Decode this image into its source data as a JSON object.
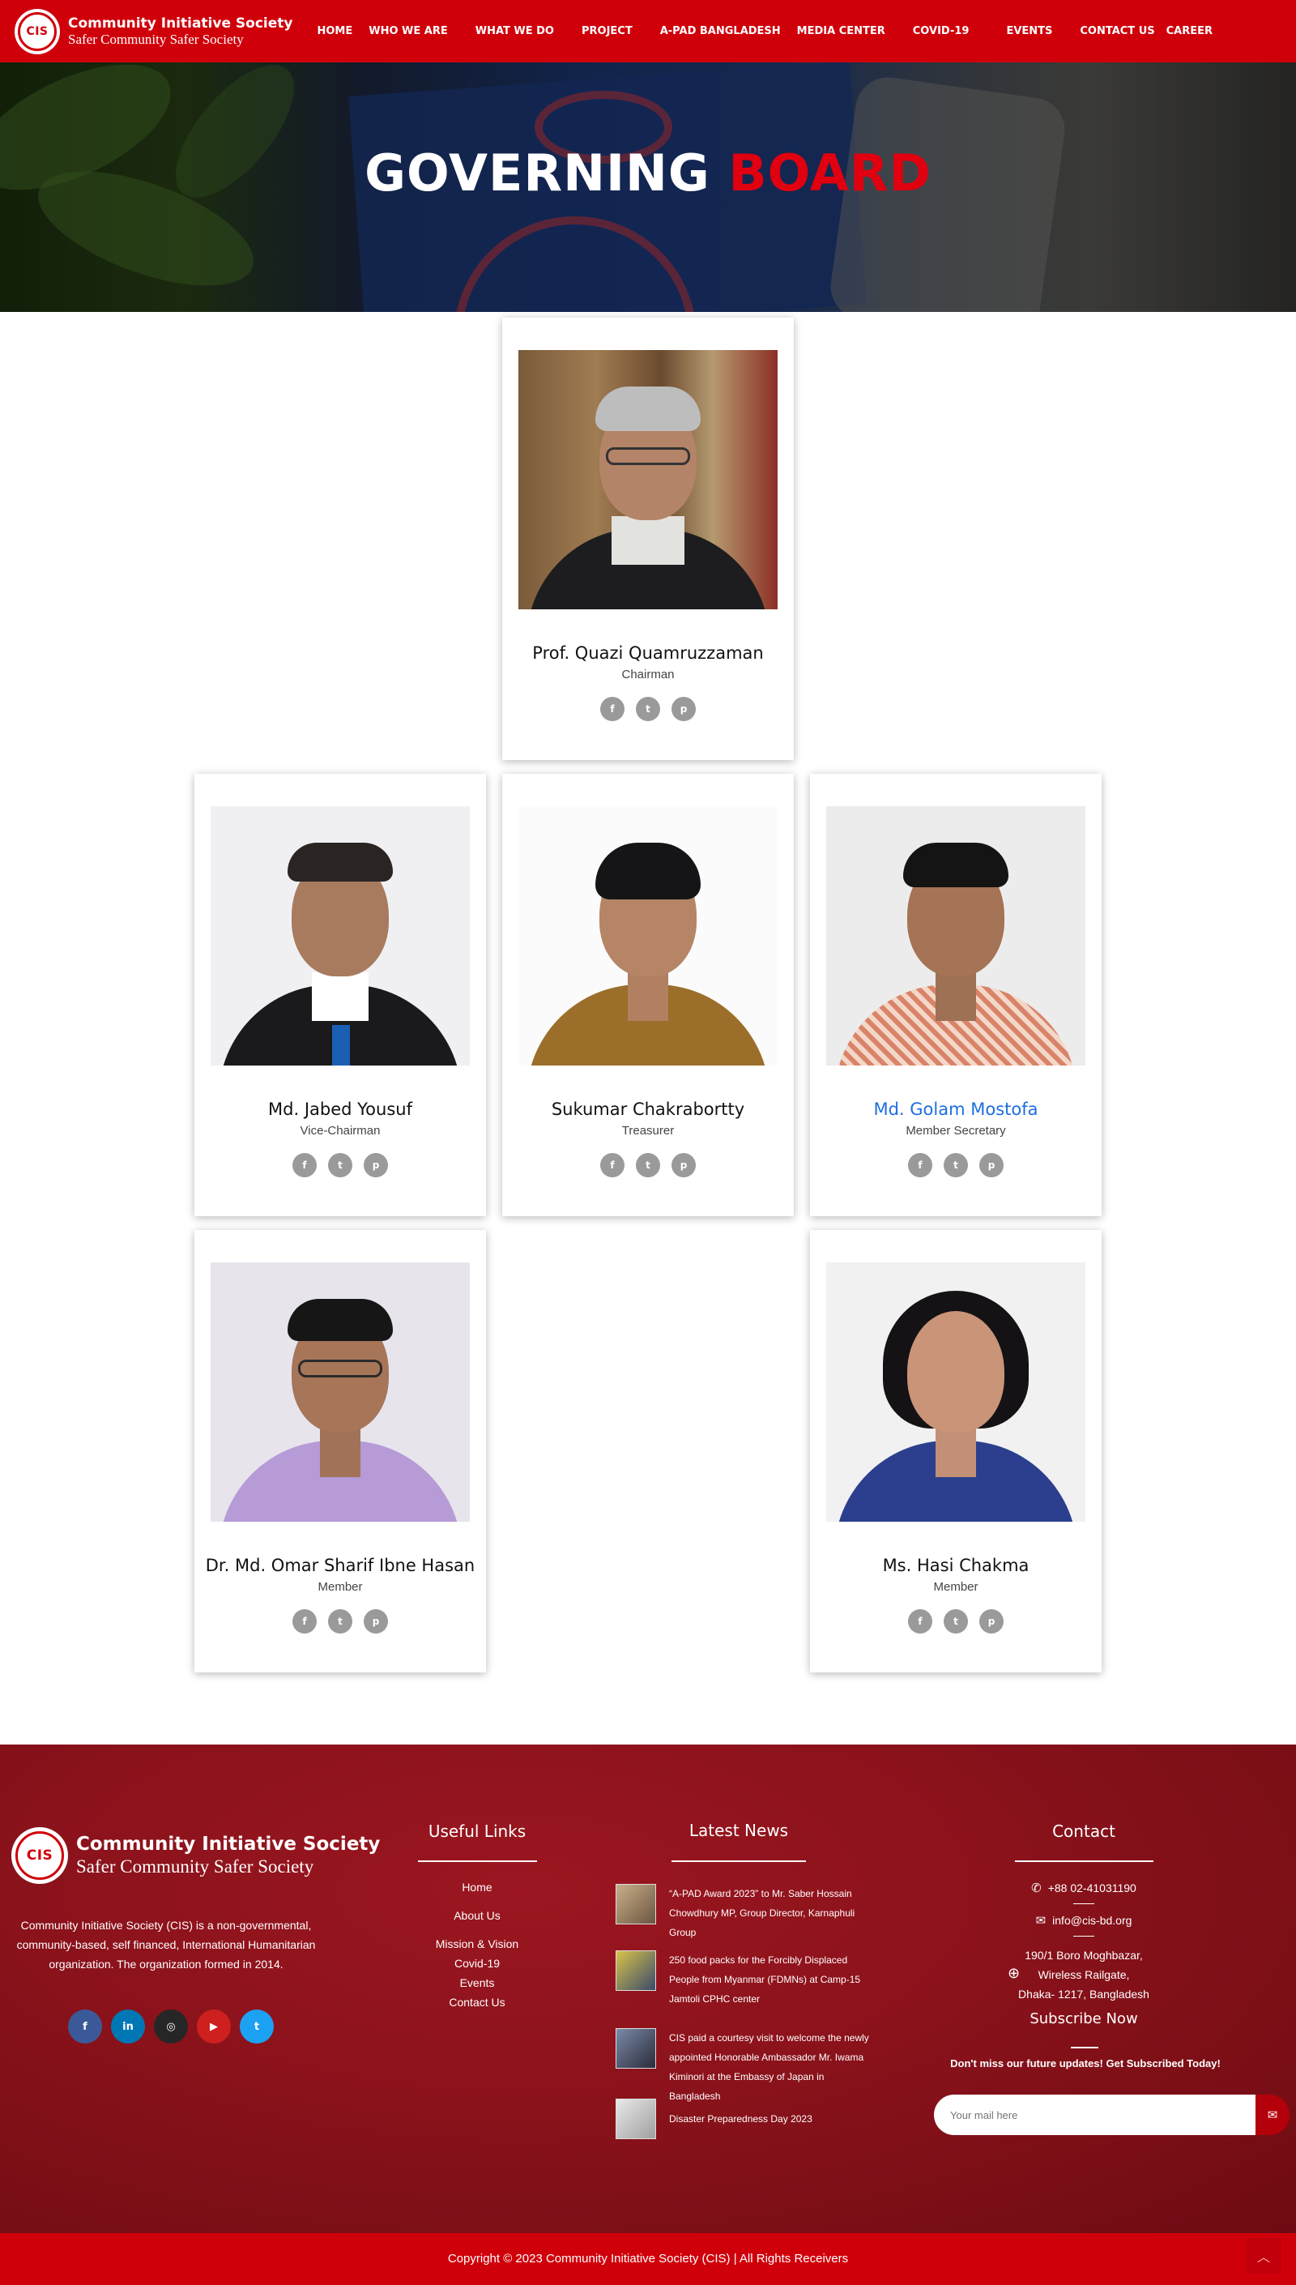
{
  "site": {
    "logo_text": "CIS",
    "name": "Community Initiative Society",
    "tagline": "Safer Community Safer Society"
  },
  "nav": {
    "items": [
      {
        "label": "HOME"
      },
      {
        "label": "WHO WE ARE"
      },
      {
        "label": "WHAT WE DO"
      },
      {
        "label": "PROJECT"
      },
      {
        "label": "A-PAD BANGLADESH"
      },
      {
        "label": "MEDIA CENTER"
      },
      {
        "label": "COVID-19"
      },
      {
        "label": "EVENTS"
      },
      {
        "label": "CONTACT US"
      },
      {
        "label": "CAREER"
      }
    ]
  },
  "hero": {
    "title_white": "GOVERNING",
    "title_red": "BOARD"
  },
  "members": [
    {
      "name": "Prof. Quazi Quamruzzaman",
      "role": "Chairman"
    },
    {
      "name": "Md. Jabed Yousuf",
      "role": "Vice-Chairman"
    },
    {
      "name": "Sukumar Chakrabortty",
      "role": "Treasurer"
    },
    {
      "name": "Md. Golam Mostofa",
      "role": "Member Secretary"
    },
    {
      "name": "Dr. Md. Omar Sharif Ibne Hasan",
      "role": "Member"
    },
    {
      "name": "Ms. Hasi Chakma",
      "role": "Member"
    }
  ],
  "member_socials": [
    {
      "icon": "facebook-icon",
      "glyph": "f"
    },
    {
      "icon": "twitter-icon",
      "glyph": "t"
    },
    {
      "icon": "pinterest-icon",
      "glyph": "p"
    }
  ],
  "footer": {
    "about": "Community Initiative Society (CIS) is a non-governmental, community-based, self financed, International Humanitarian organization. The organization formed in 2014.",
    "social": [
      {
        "icon": "facebook-icon",
        "glyph": "f",
        "color": "#3b5998"
      },
      {
        "icon": "linkedin-icon",
        "glyph": "in",
        "color": "#0077b5"
      },
      {
        "icon": "instagram-icon",
        "glyph": "◎",
        "color": "#262626"
      },
      {
        "icon": "youtube-icon",
        "glyph": "▶",
        "color": "#cd201f"
      },
      {
        "icon": "twitter-icon",
        "glyph": "t",
        "color": "#1da1f2"
      }
    ],
    "useful_links": {
      "title": "Useful Links",
      "items": [
        "Home",
        "About Us",
        "Mission & Vision",
        "Covid-19",
        "Events",
        "Contact Us"
      ]
    },
    "latest_news": {
      "title": "Latest News",
      "items": [
        "“A-PAD Award 2023” to Mr. Saber Hossain Chowdhury MP, Group Director, Karnaphuli Group",
        "250 food packs for the Forcibly Displaced People from Myanmar (FDMNs) at Camp-15 Jamtoli CPHC center",
        "CIS paid a courtesy visit to welcome the newly appointed Honorable Ambassador Mr. Iwama Kiminori at the Embassy of Japan in Bangladesh",
        "Disaster Preparedness Day 2023"
      ]
    },
    "contact": {
      "title": "Contact",
      "phone": "+88 02-41031190",
      "email": "info@cis-bd.org",
      "address_lines": [
        "190/1 Boro Moghbazar,",
        "Wireless Railgate,",
        "Dhaka- 1217, Bangladesh"
      ],
      "subscribe_title": "Subscribe Now",
      "subscribe_text": "Don't miss our future updates! Get Subscribed Today!",
      "subscribe_placeholder": "Your mail here"
    },
    "copyright": "Copyright © 2023 Community Initiative Society (CIS) | All Rights Receivers"
  }
}
